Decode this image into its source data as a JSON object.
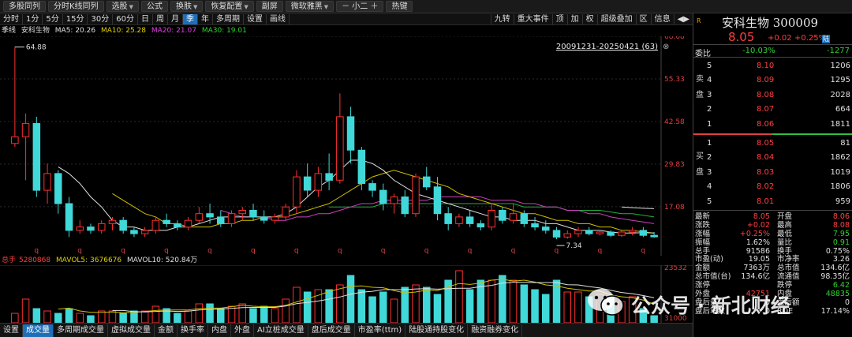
{
  "toolbar": [
    {
      "label": "多股同列",
      "caret": false
    },
    {
      "label": "分时K线同列",
      "caret": false
    },
    {
      "label": "选股",
      "caret": true
    },
    {
      "label": "公式",
      "caret": false
    },
    {
      "label": "换肤",
      "caret": true
    },
    {
      "label": "恢复配置",
      "caret": true
    },
    {
      "label": "副屏",
      "caret": false
    },
    {
      "label": "微软雅黑",
      "caret": true
    },
    {
      "label": "－  小二  ＋",
      "caret": false
    },
    {
      "label": "热键",
      "caret": false
    }
  ],
  "periods": [
    "分时",
    "1分",
    "5分",
    "15分",
    "30分",
    "60分",
    "日",
    "周",
    "月",
    "季",
    "年",
    "多周期",
    "设置",
    "画线"
  ],
  "active_period": "季",
  "right_tools": [
    "九转",
    "重大事件",
    "顶",
    "加",
    "权",
    "超级叠加",
    "区",
    "信息",
    "◀▶"
  ],
  "ma_row": {
    "label": "季线",
    "stock": "安科生物",
    "ma5": "MA5: 20.26",
    "ma10": "MA10: 25.28",
    "ma20": "MA20: 21.07",
    "ma30": "MA30: 19.01"
  },
  "range_label": "20091231-20250421 (63)",
  "range_close": "⊗",
  "max_marker": "64.88",
  "min_marker": "7.34",
  "q_mark": "q",
  "vol_row": {
    "label": "总手",
    "total": "5280868",
    "mavol5": "MAVOL5: 3676676",
    "mavol10": "MAVOL10: 520.84万"
  },
  "bottom_tabs": [
    "设置",
    "成交量",
    "多周期成交量",
    "虚拟成交量",
    "金额",
    "换手率",
    "内盘",
    "外盘",
    "AI立桩成交量",
    "盘后成交量",
    "市盈率(ttm)",
    "陆股通持股变化",
    "融资融券变化"
  ],
  "active_tab": "成交量",
  "panel": {
    "r_badge": "R",
    "name": "安科生物 300009",
    "price": "8.05",
    "chg": "+0.02",
    "chgp": "+0.25%",
    "lu": "陆",
    "wb_label": "委比",
    "wb_pct": "-10.03%",
    "wb_num": "-1277",
    "sell_label": "卖盘",
    "buy_label": "买盘",
    "asks": [
      {
        "n": "5",
        "p": "8.10",
        "v": "1206"
      },
      {
        "n": "4",
        "p": "8.09",
        "v": "1295"
      },
      {
        "n": "3",
        "p": "8.08",
        "v": "2028"
      },
      {
        "n": "2",
        "p": "8.07",
        "v": "664"
      },
      {
        "n": "1",
        "p": "8.06",
        "v": "1811"
      }
    ],
    "bids": [
      {
        "n": "1",
        "p": "8.05",
        "v": "81"
      },
      {
        "n": "2",
        "p": "8.04",
        "v": "1862"
      },
      {
        "n": "3",
        "p": "8.03",
        "v": "1019"
      },
      {
        "n": "4",
        "p": "8.02",
        "v": "1806"
      },
      {
        "n": "5",
        "p": "8.01",
        "v": "959"
      }
    ],
    "stats": [
      {
        "l": "最新",
        "v": "8.05",
        "vc": "red",
        "l2": "开盘",
        "v2": "8.06",
        "v2c": "red"
      },
      {
        "l": "涨跌",
        "v": "+0.02",
        "vc": "red",
        "l2": "最高",
        "v2": "8.08",
        "v2c": "red"
      },
      {
        "l": "涨幅",
        "v": "+0.25%",
        "vc": "red",
        "l2": "最低",
        "v2": "7.95",
        "v2c": "grn"
      },
      {
        "l": "振幅",
        "v": "1.62%",
        "vc": "wht",
        "l2": "量比",
        "v2": "0.91",
        "v2c": "grn"
      },
      {
        "l": "总手",
        "v": "91586",
        "vc": "wht",
        "l2": "换手",
        "v2": "0.75%",
        "v2c": "wht"
      },
      {
        "l": "市盈(动)",
        "v": "19.05",
        "vc": "wht",
        "l2": "市净率",
        "v2": "3.26",
        "v2c": "wht"
      },
      {
        "l": "金额",
        "v": "7363万",
        "vc": "wht",
        "l2": "总市值",
        "v2": "134.6亿",
        "v2c": "wht"
      },
      {
        "l": "总市值(台)",
        "v": "134.6亿",
        "vc": "wht",
        "l2": "流通值",
        "v2": "98.35亿",
        "v2c": "wht"
      },
      {
        "l": "涨停",
        "v": "",
        "vc": "red",
        "l2": "跌停",
        "v2": "6.42",
        "v2c": "grn"
      },
      {
        "l": "外盘",
        "v": "42751",
        "vc": "red",
        "l2": "内盘",
        "v2": "48835",
        "v2c": "grn"
      },
      {
        "l": "盘后量",
        "v": "0",
        "vc": "wht",
        "l2": "盘后额",
        "v2": "0",
        "v2c": "wht"
      },
      {
        "l": "盘后笔数",
        "v": "0",
        "vc": "wht",
        "l2": "ROE",
        "v2": "17.14%",
        "v2c": "wht"
      }
    ]
  },
  "watermark": "公众号 · 新北财经",
  "chart_data": {
    "type": "candlestick",
    "title": "安科生物 季线",
    "y_ticks": [
      "68.08",
      "55.33",
      "42.58",
      "29.83",
      "17.08"
    ],
    "ylim": [
      4.3,
      68.08
    ],
    "vol_ticks": [
      "23532",
      "31000"
    ],
    "candles": [
      [
        36,
        64.88,
        35,
        38
      ],
      [
        38,
        45,
        25,
        42
      ],
      [
        42,
        44,
        20,
        22
      ],
      [
        22,
        30,
        18,
        27
      ],
      [
        27,
        28,
        15,
        18
      ],
      [
        18,
        20,
        8,
        10
      ],
      [
        10,
        13,
        9,
        11
      ],
      [
        11,
        12,
        9,
        10
      ],
      [
        10,
        13,
        9,
        12
      ],
      [
        12,
        14,
        10,
        13
      ],
      [
        13,
        14,
        9,
        10
      ],
      [
        10,
        11,
        8,
        9
      ],
      [
        9,
        11,
        8,
        10
      ],
      [
        10,
        14,
        9,
        13
      ],
      [
        13,
        15,
        11,
        12
      ],
      [
        12,
        13,
        10,
        11
      ],
      [
        11,
        14,
        10,
        13
      ],
      [
        13,
        17,
        12,
        15
      ],
      [
        15,
        18,
        12,
        14
      ],
      [
        14,
        16,
        11,
        12
      ],
      [
        12,
        16,
        11,
        15
      ],
      [
        15,
        17,
        13,
        16
      ],
      [
        16,
        18,
        13,
        14
      ],
      [
        14,
        16,
        12,
        13
      ],
      [
        13,
        15,
        12,
        14
      ],
      [
        14,
        18,
        13,
        17
      ],
      [
        17,
        28,
        15,
        26
      ],
      [
        26,
        30,
        20,
        22
      ],
      [
        22,
        29,
        20,
        27
      ],
      [
        27,
        33,
        22,
        25
      ],
      [
        25,
        51,
        24,
        44
      ],
      [
        44,
        47,
        30,
        34
      ],
      [
        34,
        35,
        22,
        24
      ],
      [
        24,
        25,
        20,
        22
      ],
      [
        22,
        24,
        16,
        18
      ],
      [
        18,
        21,
        15,
        20
      ],
      [
        20,
        22,
        14,
        15
      ],
      [
        15,
        27,
        14,
        26
      ],
      [
        26,
        29,
        22,
        23
      ],
      [
        23,
        26,
        13,
        15
      ],
      [
        15,
        17,
        10,
        12
      ],
      [
        12,
        15,
        11,
        14
      ],
      [
        14,
        16,
        11,
        12
      ],
      [
        12,
        13,
        10,
        11
      ],
      [
        11,
        18,
        10,
        16
      ],
      [
        16,
        17,
        12,
        13
      ],
      [
        13,
        18,
        12,
        15
      ],
      [
        15,
        16,
        11,
        12
      ],
      [
        12,
        14,
        10,
        11
      ],
      [
        11,
        13,
        9,
        10
      ],
      [
        10,
        11,
        7.34,
        8
      ],
      [
        8,
        10,
        7.5,
        9
      ],
      [
        9,
        11,
        8,
        10
      ],
      [
        10,
        11,
        8.5,
        9
      ],
      [
        9,
        10,
        8.5,
        9.5
      ],
      [
        9.5,
        10,
        8,
        8.5
      ],
      [
        8.5,
        10,
        8,
        9.5
      ],
      [
        9.5,
        11,
        8.5,
        10
      ],
      [
        10,
        11,
        8,
        8.5
      ],
      [
        8.5,
        9.5,
        7.8,
        8.05
      ]
    ],
    "ma5": [
      null,
      null,
      null,
      null,
      29,
      27,
      24,
      20,
      17,
      13,
      11,
      11,
      10,
      10,
      10,
      11,
      11,
      12,
      13,
      14,
      14,
      14,
      14,
      14,
      14,
      15,
      17,
      20,
      23,
      25,
      28,
      31,
      31,
      30,
      28,
      25,
      23,
      21,
      20,
      19,
      18,
      17,
      16,
      15,
      14,
      14,
      13,
      13,
      13,
      12,
      12,
      11,
      10,
      10,
      10,
      9.5,
      9.2,
      9.2,
      9.3,
      9.2
    ],
    "ma10": [
      null,
      null,
      null,
      null,
      null,
      null,
      null,
      null,
      null,
      21,
      19,
      17,
      15,
      14,
      12,
      12,
      11,
      11,
      11,
      12,
      12,
      13,
      13,
      14,
      14,
      14,
      15,
      16,
      17,
      18,
      20,
      22,
      24,
      26,
      27,
      28,
      27,
      26,
      25,
      24,
      23,
      21,
      20,
      19,
      18,
      17,
      16,
      15,
      15,
      14,
      13,
      13,
      12,
      12,
      11,
      11,
      10,
      10,
      9.5,
      9.2
    ],
    "ma20": [
      null,
      null,
      null,
      null,
      null,
      null,
      null,
      null,
      null,
      null,
      null,
      null,
      null,
      null,
      null,
      null,
      null,
      null,
      null,
      16,
      15,
      14,
      14,
      14,
      13,
      13,
      14,
      14,
      15,
      15,
      16,
      17,
      18,
      18,
      19,
      19,
      19,
      19,
      19,
      20,
      20,
      20,
      20,
      20,
      19,
      19,
      19,
      18,
      18,
      17,
      17,
      16,
      16,
      15,
      15,
      14,
      13.5,
      13,
      12.5,
      12
    ],
    "ma30": [
      null,
      null,
      null,
      null,
      null,
      null,
      null,
      null,
      null,
      null,
      null,
      null,
      null,
      null,
      null,
      null,
      null,
      null,
      null,
      null,
      null,
      null,
      null,
      null,
      null,
      null,
      null,
      null,
      null,
      17,
      17,
      17,
      17,
      17,
      18,
      18,
      18,
      18,
      18,
      18,
      18,
      18,
      18,
      18,
      18,
      18,
      18,
      17,
      17,
      17,
      17,
      16,
      16,
      16,
      16,
      15.5,
      15,
      15,
      14.5,
      14
    ],
    "ma_extra": [
      null,
      null,
      null,
      null,
      null,
      null,
      null,
      null,
      null,
      null,
      null,
      null,
      null,
      null,
      null,
      null,
      null,
      null,
      null,
      null,
      null,
      null,
      null,
      null,
      null,
      null,
      null,
      null,
      null,
      null,
      null,
      null,
      null,
      null,
      null,
      null,
      null,
      null,
      null,
      null,
      null,
      null,
      null,
      null,
      null,
      null,
      null,
      null,
      null,
      null,
      null,
      null,
      null,
      null,
      null,
      null,
      17,
      16.8,
      16.6,
      16.5
    ],
    "volumes": [
      2,
      5,
      3,
      2.5,
      2,
      3,
      2,
      1.5,
      2.5,
      2.5,
      2,
      2.5,
      2.5,
      3.5,
      3,
      2,
      2.5,
      4,
      4,
      3,
      3.5,
      4,
      3,
      3.5,
      3,
      5,
      7.5,
      6.5,
      7,
      7,
      8,
      10,
      7,
      5.5,
      6.5,
      5,
      7.5,
      8,
      7.5,
      6,
      9,
      11,
      7,
      9,
      9,
      10,
      9,
      8,
      7,
      6,
      9,
      6.5,
      6.5,
      5.5,
      6,
      5,
      4.5,
      5.5,
      3,
      1.5
    ]
  }
}
